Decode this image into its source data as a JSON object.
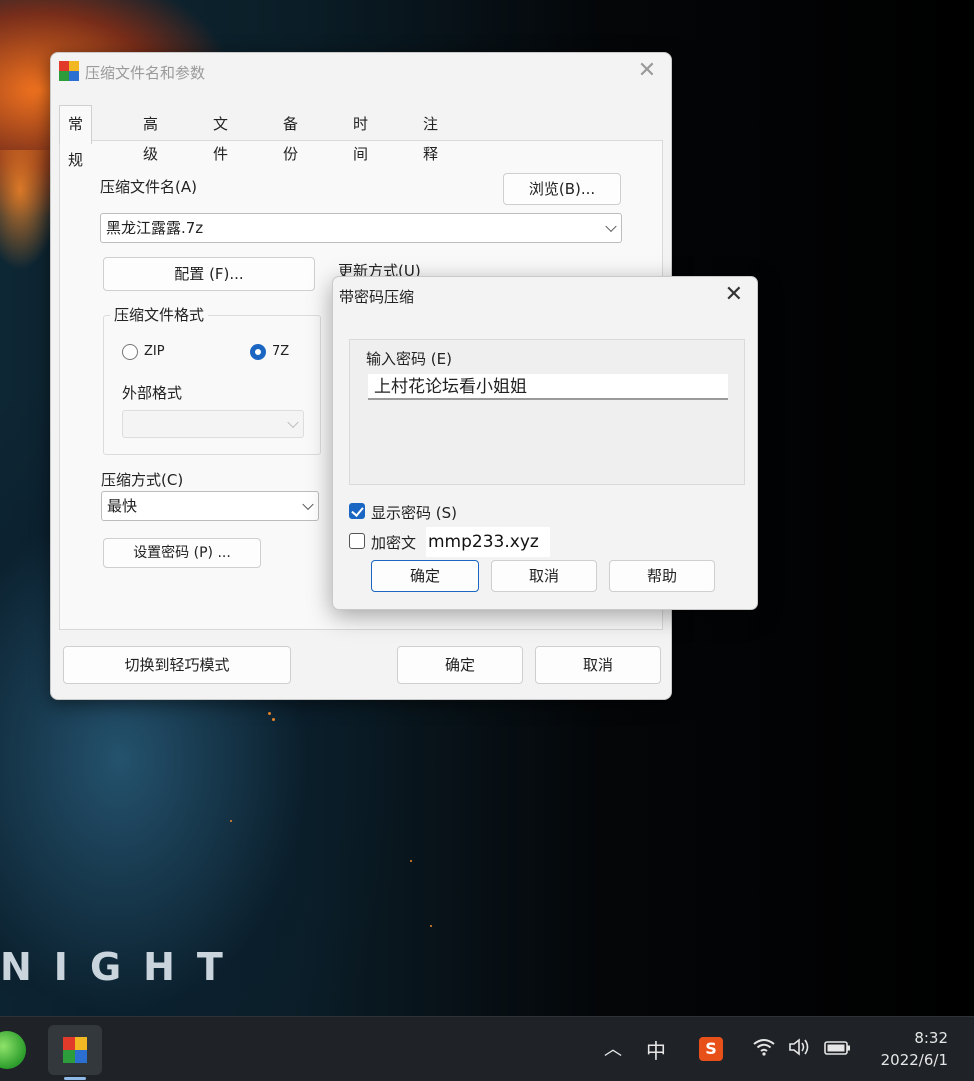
{
  "wallpaper": {
    "text": "NIGHT"
  },
  "main_window": {
    "title": "压缩文件名和参数",
    "close_glyph": "✕",
    "tabs": [
      "常规",
      "高级",
      "文件",
      "备份",
      "时间",
      "注释"
    ],
    "archive_name_label": "压缩文件名(A)",
    "browse_button": "浏览(B)...",
    "archive_name_value": "黑龙江露露.7z",
    "profiles_button": "配置 (F)...",
    "update_mode_label": "更新方式(U)",
    "format_group_title": "压缩文件格式",
    "format_zip": "ZIP",
    "format_7z": "7Z",
    "format_selected": "7Z",
    "external_format_label": "外部格式",
    "external_format_value": "",
    "method_label": "压缩方式(C)",
    "method_value": "最快",
    "set_password_button": "设置密码 (P) ...",
    "switch_mode_button": "切换到轻巧模式",
    "ok_button": "确定",
    "cancel_button": "取消"
  },
  "password_dialog": {
    "title": "带密码压缩",
    "close_glyph": "✕",
    "enter_password_label": "输入密码 (E)",
    "password_value": "上村花论坛看小姐姐",
    "show_password_label": "显示密码 (S)",
    "show_password_checked": true,
    "encrypt_names_label": "加密文",
    "encrypt_names_checked": false,
    "ok_button": "确定",
    "cancel_button": "取消",
    "help_button": "帮助"
  },
  "watermark": "mmp233.xyz",
  "taskbar": {
    "tray_chevron": "︿",
    "ime_label": "中",
    "sogou_label": "S",
    "wifi_icon": "wifi-icon",
    "volume_icon": "volume-icon",
    "battery_icon": "battery-icon",
    "time": "8:32",
    "date": "2022/6/1"
  },
  "colors": {
    "accent": "#1a66c2",
    "taskbar": "#1f2327",
    "window_bg": "#f3f3f3"
  }
}
